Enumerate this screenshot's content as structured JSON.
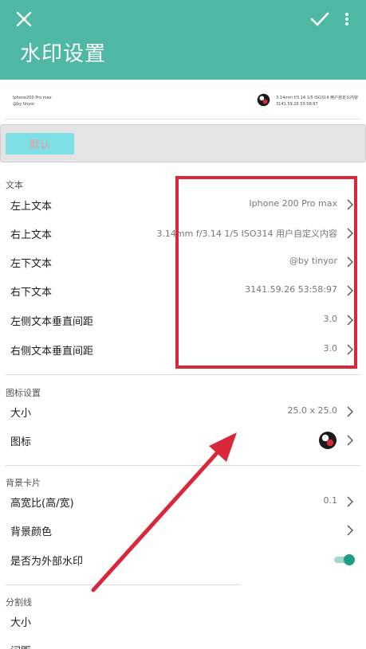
{
  "appbar": {
    "title": "水印设置",
    "close_icon": "close-icon",
    "confirm_icon": "check-icon",
    "more_icon": "more-vert-icon"
  },
  "preview": {
    "top_left_line1": "Iphone200 Pro max",
    "top_left_line2": "@by tinyor",
    "top_right_line1": "3.14mm f/3.14 1/5 ISO314 用户自定义内容",
    "top_right_line2": "3141.59.26 53:58:97"
  },
  "buttons": {
    "confirm": "默认"
  },
  "text_section": {
    "header": "文本",
    "rows": [
      {
        "label": "左上文本",
        "value": "Iphone 200 Pro max"
      },
      {
        "label": "右上文本",
        "value": "3.14mm f/3.14 1/5 ISO314 用户自定义内容"
      },
      {
        "label": "左下文本",
        "value": "@by tinyor"
      },
      {
        "label": "右下文本",
        "value": "3141.59.26 53:58:97"
      },
      {
        "label": "左侧文本垂直间距",
        "value": "3.0"
      },
      {
        "label": "右侧文本垂直间距",
        "value": "3.0"
      }
    ]
  },
  "icon_section": {
    "header": "图标设置",
    "size_label": "大小",
    "size_value": "25.0 x 25.0",
    "icon_label": "图标"
  },
  "card_section": {
    "header": "背景卡片",
    "ratio_label": "高宽比(高/宽)",
    "ratio_value": "0.1",
    "color_label": "背景颜色",
    "external_label": "是否为外部水印",
    "external_enabled": true
  },
  "divider_section": {
    "header": "分割线",
    "size_label": "大小",
    "spacing_label": "间距"
  },
  "colors": {
    "appbar": "#4fb8a4",
    "accent": "#1f9d86",
    "annotation": "#d8283a"
  }
}
